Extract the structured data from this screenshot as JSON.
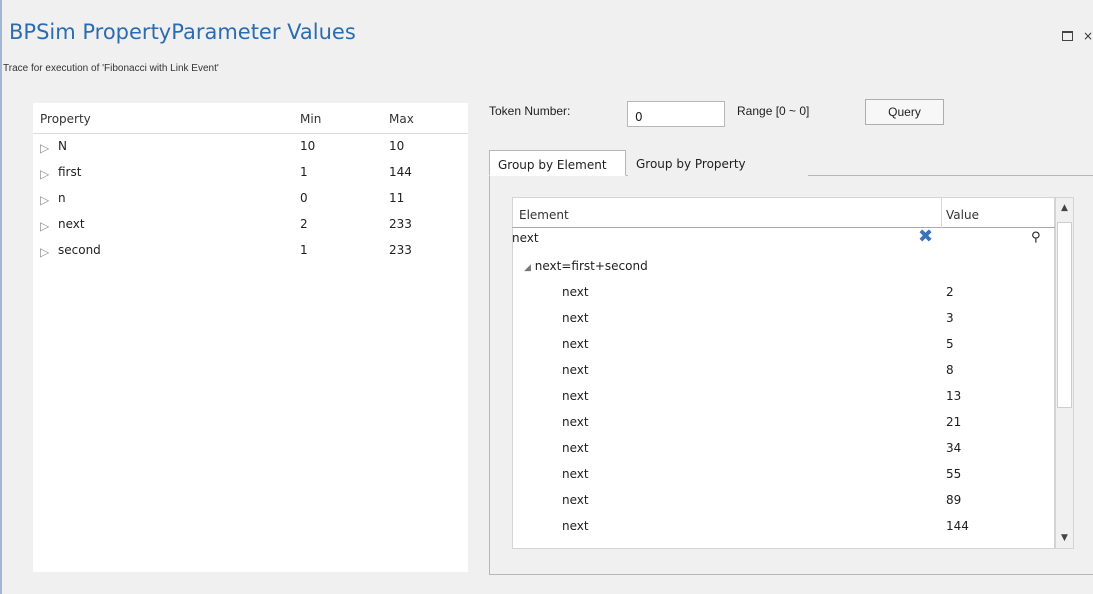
{
  "window": {
    "title": "BPSim PropertyParameter Values",
    "subtitle": "Trace for execution of 'Fibonacci with Link Event'",
    "maximize_icon": "maximize-icon",
    "close_glyph": "×"
  },
  "properties_table": {
    "headers": {
      "property": "Property",
      "min": "Min",
      "max": "Max"
    },
    "rows": [
      {
        "name": "N",
        "min": "10",
        "max": "10"
      },
      {
        "name": "first",
        "min": "1",
        "max": "144"
      },
      {
        "name": "n",
        "min": "0",
        "max": "11"
      },
      {
        "name": "next",
        "min": "2",
        "max": "233"
      },
      {
        "name": "second",
        "min": "1",
        "max": "233"
      }
    ],
    "expand_glyph": "▷"
  },
  "toolbar": {
    "token_label": "Token Number:",
    "token_value": "0",
    "range_label": "Range [0 ~ 0]",
    "query_label": "Query"
  },
  "tabs": [
    {
      "label": "Group by Element",
      "active": true
    },
    {
      "label": "Group by Property",
      "active": false
    }
  ],
  "element_grid": {
    "headers": {
      "element": "Element",
      "value": "Value"
    },
    "filter_value": "next",
    "group": {
      "glyph": "◢",
      "label": "next=first+second"
    },
    "rows": [
      {
        "element": "next",
        "value": "2"
      },
      {
        "element": "next",
        "value": "3"
      },
      {
        "element": "next",
        "value": "5"
      },
      {
        "element": "next",
        "value": "8"
      },
      {
        "element": "next",
        "value": "13"
      },
      {
        "element": "next",
        "value": "21"
      },
      {
        "element": "next",
        "value": "34"
      },
      {
        "element": "next",
        "value": "55"
      },
      {
        "element": "next",
        "value": "89"
      },
      {
        "element": "next",
        "value": "144"
      }
    ]
  },
  "colors": {
    "title": "#2b6cb0",
    "clear_icon": "#3b73b9",
    "accent_frame": "#9fb7d2"
  }
}
